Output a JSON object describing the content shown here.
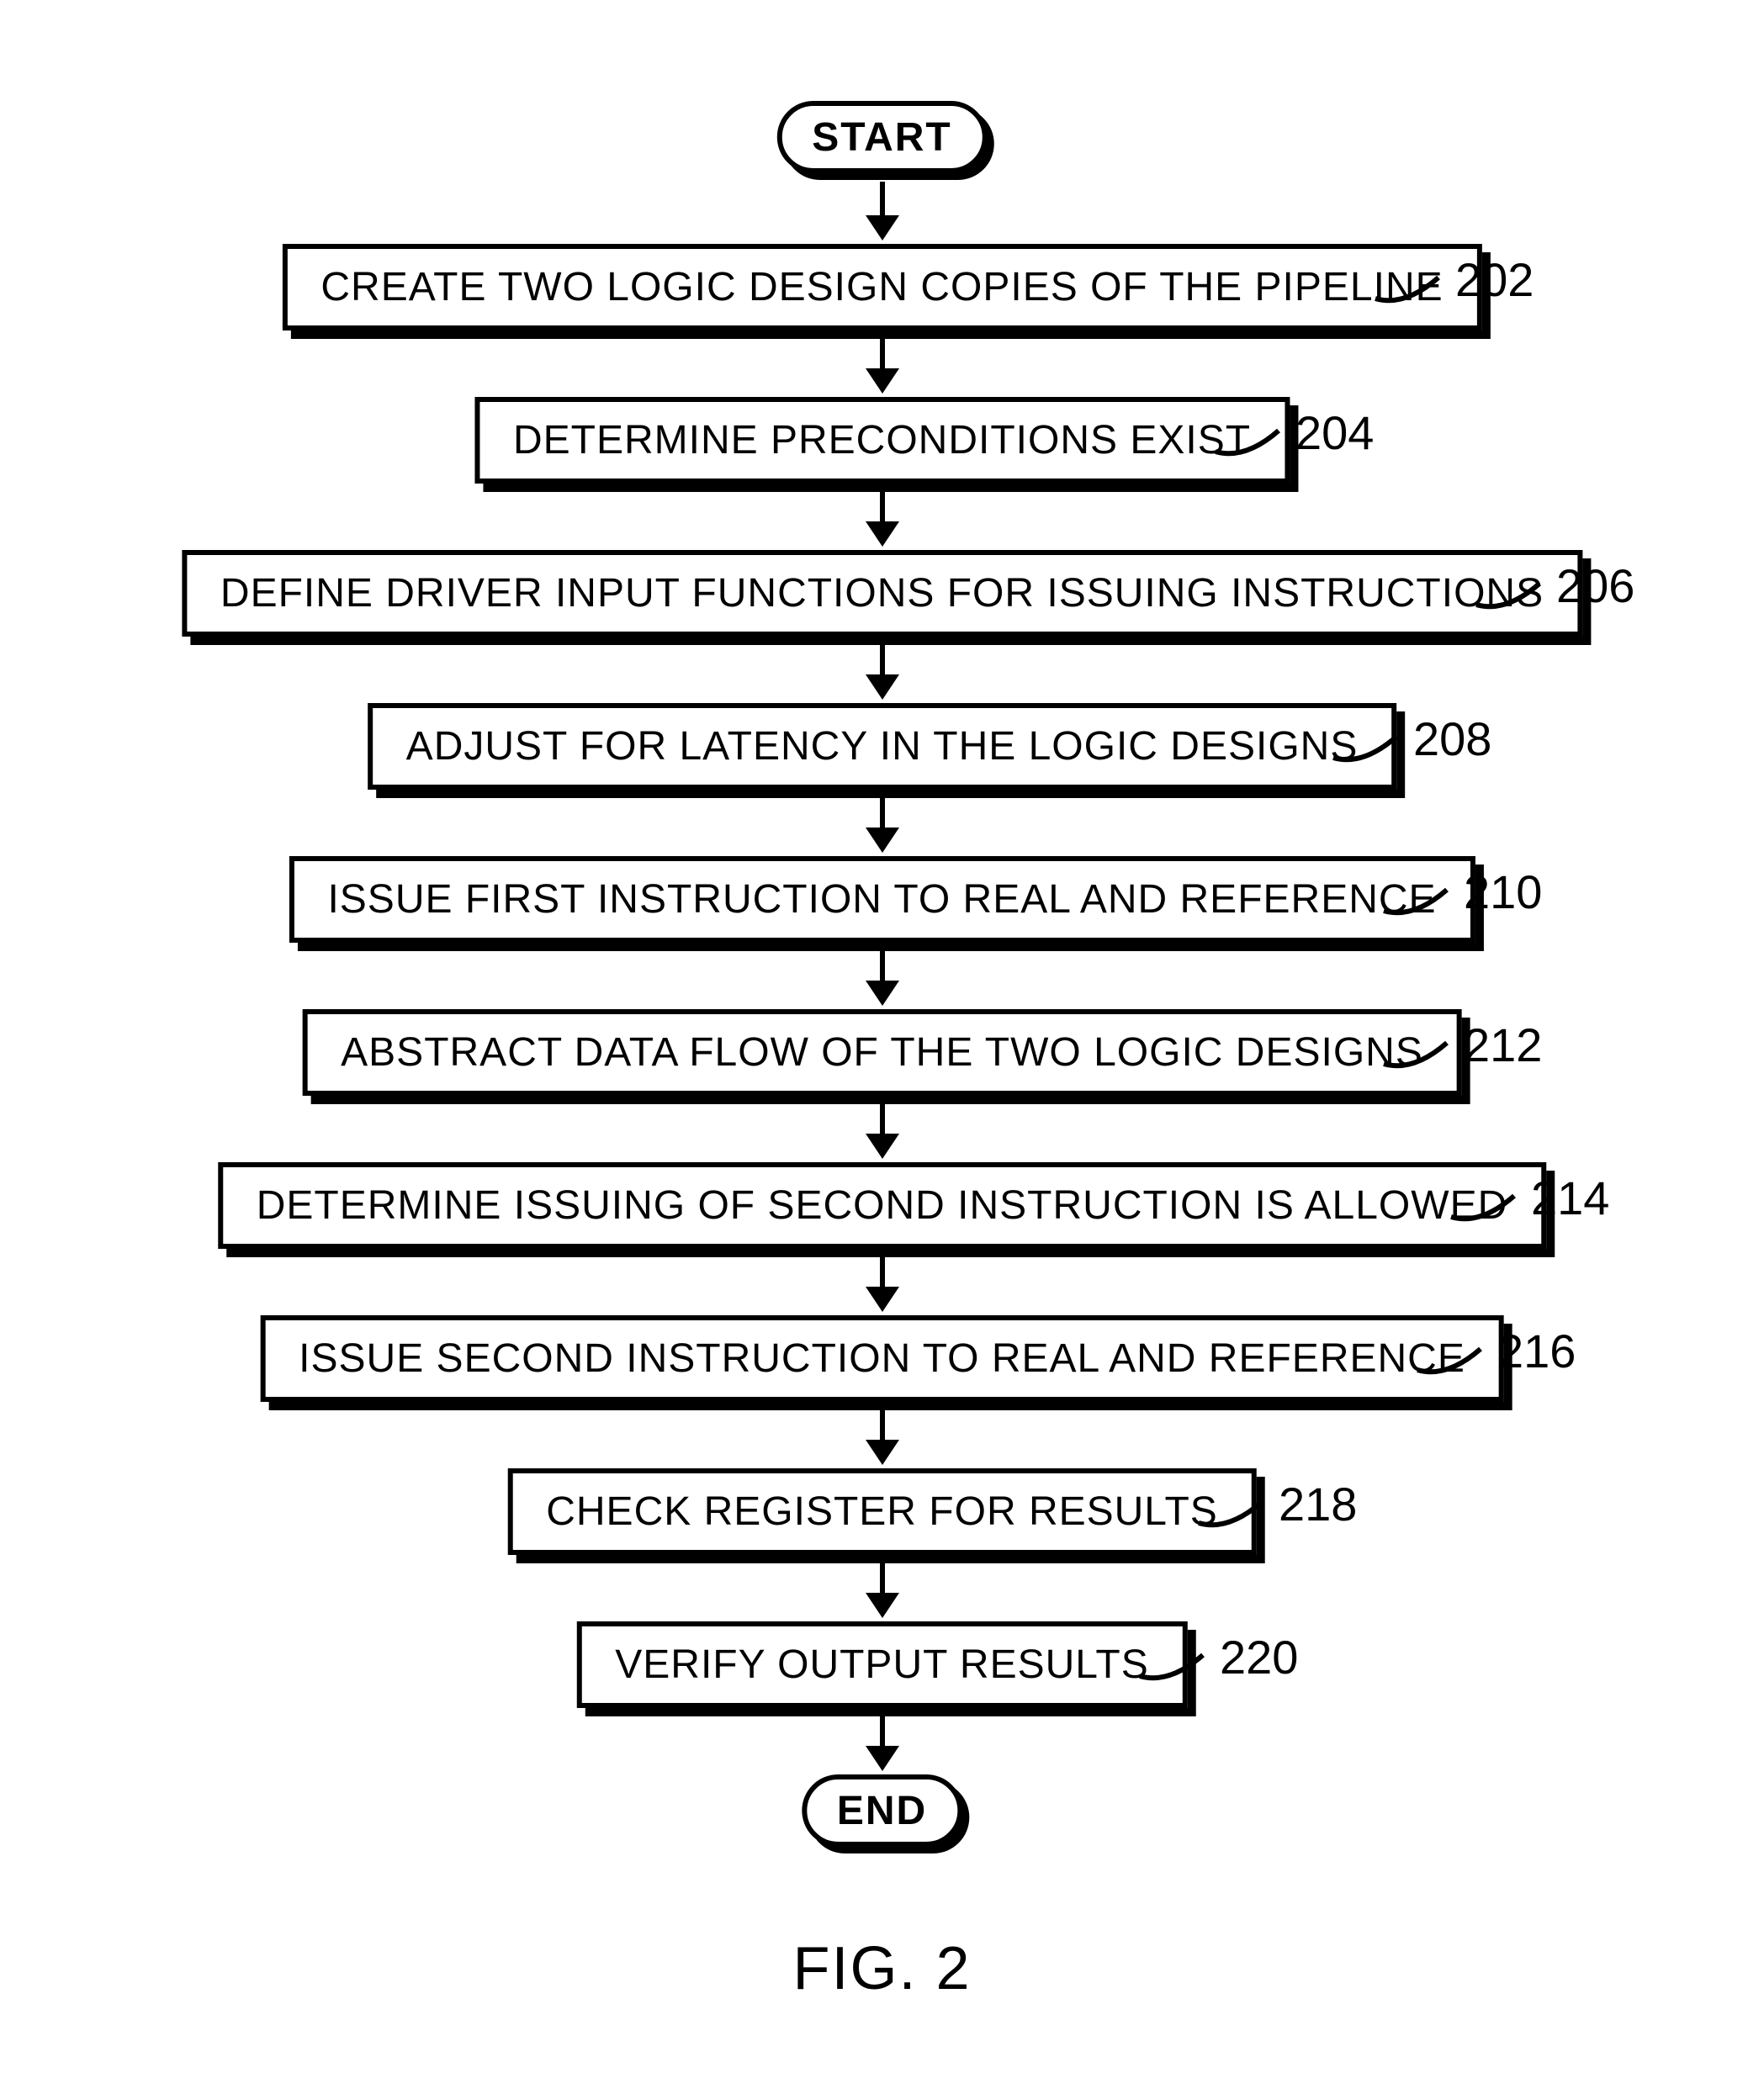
{
  "flowchart": {
    "start_label": "START",
    "end_label": "END",
    "steps": [
      {
        "text": "CREATE TWO LOGIC DESIGN COPIES OF THE PIPELINE",
        "ref": "202"
      },
      {
        "text": "DETERMINE PRECONDITIONS EXIST",
        "ref": "204"
      },
      {
        "text": "DEFINE DRIVER INPUT FUNCTIONS FOR ISSUING INSTRUCTIONS",
        "ref": "206"
      },
      {
        "text": "ADJUST FOR LATENCY IN THE LOGIC DESIGNS",
        "ref": "208"
      },
      {
        "text": "ISSUE FIRST INSTRUCTION TO REAL AND REFERENCE",
        "ref": "210"
      },
      {
        "text": "ABSTRACT DATA FLOW OF THE TWO LOGIC DESIGNS",
        "ref": "212"
      },
      {
        "text": "DETERMINE ISSUING OF SECOND INSTRUCTION IS ALLOWED",
        "ref": "214"
      },
      {
        "text": "ISSUE SECOND INSTRUCTION TO REAL AND REFERENCE",
        "ref": "216"
      },
      {
        "text": "CHECK REGISTER FOR RESULTS",
        "ref": "218"
      },
      {
        "text": "VERIFY OUTPUT RESULTS",
        "ref": "220"
      }
    ],
    "figure_label": "FIG. 2"
  }
}
